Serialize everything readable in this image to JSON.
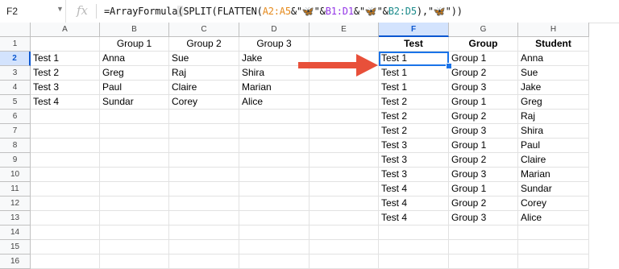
{
  "name_box": "F2",
  "fx_icon": "fx-icon",
  "formula": {
    "fn": "=ArrayFormula",
    "open1": "(",
    "split": "SPLIT(FLATTEN(",
    "r1": "A2:A5",
    "amp1": "&\"",
    "sep1": "🦋",
    "amp2": "\"&",
    "r2": "B1:D1",
    "amp3": "&\"",
    "sep2": "🦋",
    "amp4": "\"&",
    "r3": "B2:D5",
    "close": "),\"",
    "sep3": "🦋",
    "end": "\"))"
  },
  "columns": [
    "A",
    "B",
    "C",
    "D",
    "E",
    "F",
    "G",
    "H"
  ],
  "rows": [
    "1",
    "2",
    "3",
    "4",
    "5",
    "6",
    "7",
    "8",
    "9",
    "10",
    "11",
    "12",
    "13",
    "14",
    "15",
    "16"
  ],
  "selected_cell": "F2",
  "source_table": {
    "headers": [
      "",
      "Group 1",
      "Group 2",
      "Group 3"
    ],
    "rows": [
      [
        "Test 1",
        "Anna",
        "Sue",
        "Jake"
      ],
      [
        "Test 2",
        "Greg",
        "Raj",
        "Shira"
      ],
      [
        "Test 3",
        "Paul",
        "Claire",
        "Marian"
      ],
      [
        "Test 4",
        "Sundar",
        "Corey",
        "Alice"
      ]
    ]
  },
  "result_table": {
    "headers": [
      "Test",
      "Group",
      "Student"
    ],
    "rows": [
      [
        "Test 1",
        "Group 1",
        "Anna"
      ],
      [
        "Test 1",
        "Group 2",
        "Sue"
      ],
      [
        "Test 1",
        "Group 3",
        "Jake"
      ],
      [
        "Test 2",
        "Group 1",
        "Greg"
      ],
      [
        "Test 2",
        "Group 2",
        "Raj"
      ],
      [
        "Test 2",
        "Group 3",
        "Shira"
      ],
      [
        "Test 3",
        "Group 1",
        "Paul"
      ],
      [
        "Test 3",
        "Group 2",
        "Claire"
      ],
      [
        "Test 3",
        "Group 3",
        "Marian"
      ],
      [
        "Test 4",
        "Group 1",
        "Sundar"
      ],
      [
        "Test 4",
        "Group 2",
        "Corey"
      ],
      [
        "Test 4",
        "Group 3",
        "Alice"
      ]
    ]
  },
  "colors": {
    "selection": "#1a73e8",
    "arrow": "#e8503a",
    "header_bg": "#f8f9fa"
  }
}
